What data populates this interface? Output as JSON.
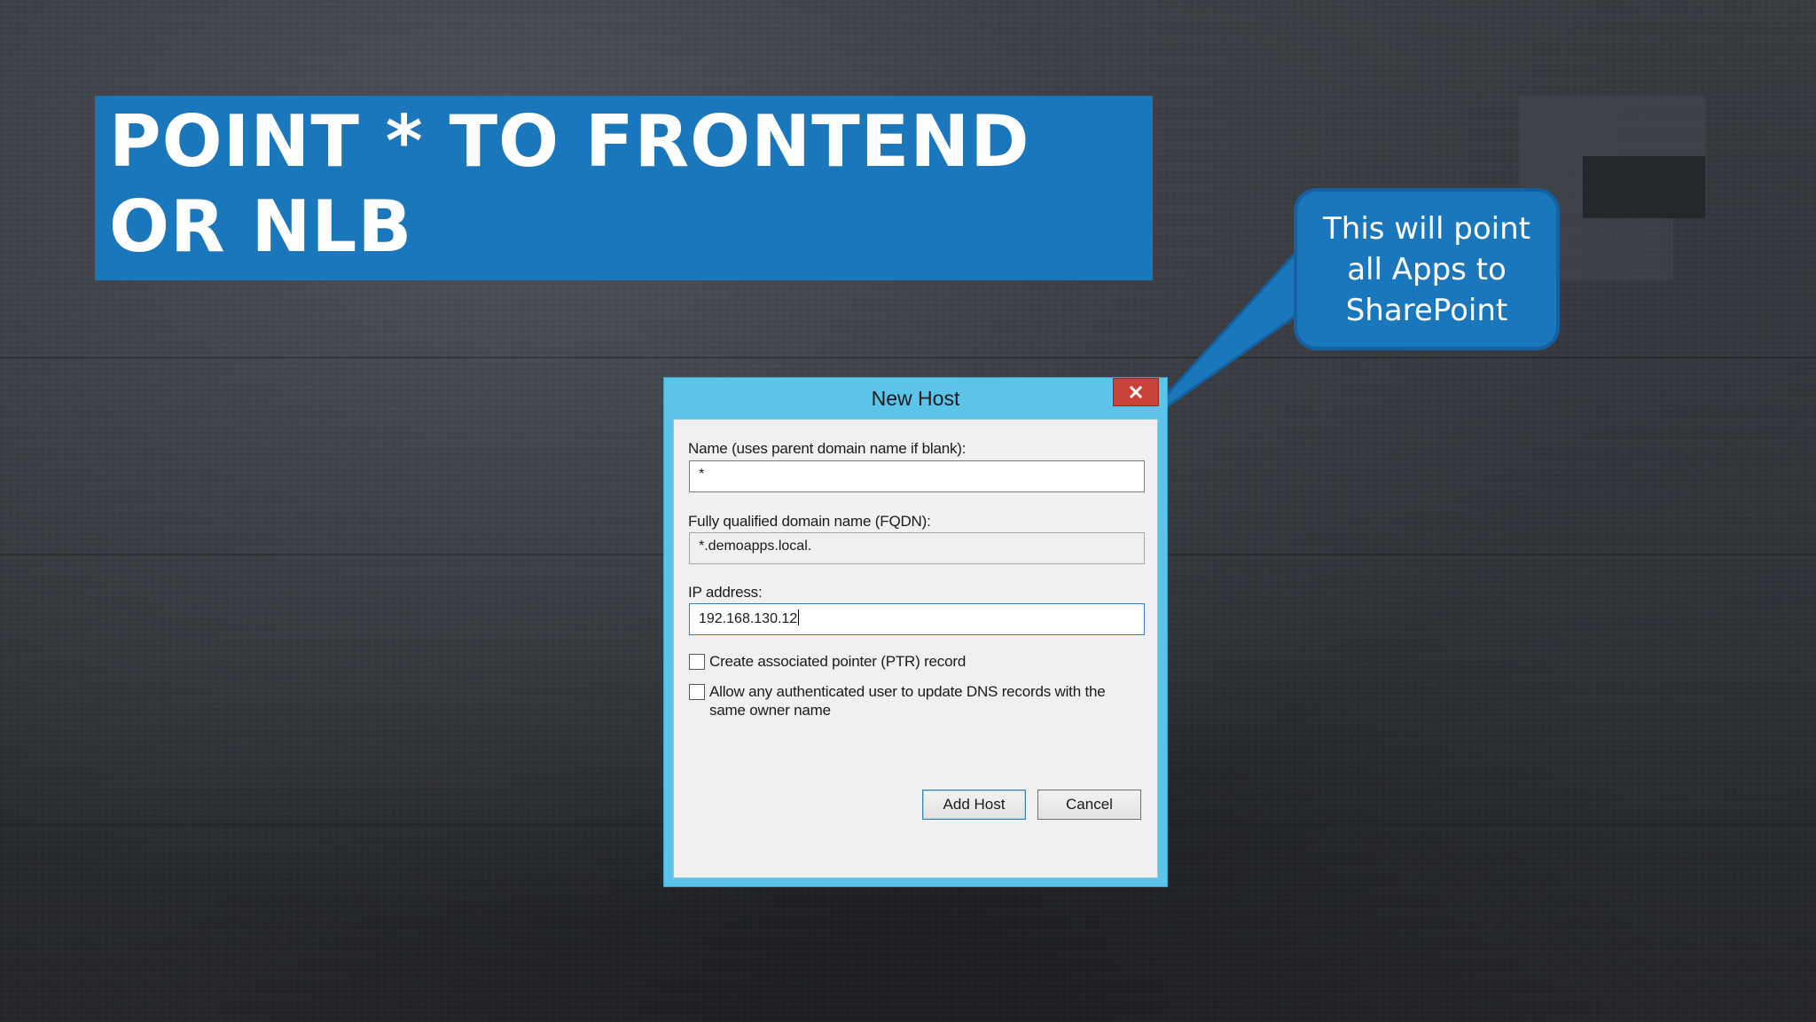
{
  "slide": {
    "title": "POINT * TO FRONTEND OR NLB",
    "callout_text": "This will point all Apps to SharePoint"
  },
  "dialog": {
    "title": "New Host",
    "close_icon": "close-icon",
    "name_label": "Name (uses parent domain name if blank):",
    "name_value": "*",
    "fqdn_label": "Fully qualified domain name (FQDN):",
    "fqdn_value": "*.demoapps.local.",
    "ip_label": "IP address:",
    "ip_value": "192.168.130.12",
    "ptr_checkbox_label": "Create associated pointer (PTR) record",
    "ptr_checked": false,
    "allow_checkbox_label": "Allow any authenticated user to update DNS records with the same owner name",
    "allow_checked": false,
    "add_host_label": "Add Host",
    "cancel_label": "Cancel"
  },
  "colors": {
    "banner": "#1a77bb",
    "dialog_frame": "#5bc4e8",
    "close_button": "#c7433a"
  }
}
